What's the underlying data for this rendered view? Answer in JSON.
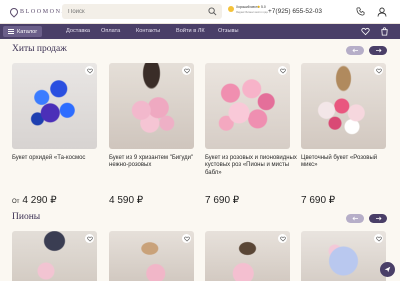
{
  "header": {
    "brand": "BLOOMONA",
    "search_placeholder": "Поиск",
    "rating": {
      "brand": "Яндекс",
      "label": "Хороший место",
      "score": "5.0",
      "sub": "Яндекс Бизнес место года"
    },
    "phone": "+7(925) 655-52-03"
  },
  "nav": {
    "catalog": "Каталог",
    "items": [
      "Доставка",
      "Оплата",
      "Контакты",
      "Войти в ЛК",
      "Отзывы"
    ]
  },
  "sections": [
    {
      "title": "Хиты продаж",
      "products": [
        {
          "name": "Букет орхидей «Та-космос",
          "price_prefix": "От",
          "price": "4 290 ₽"
        },
        {
          "name": "Букет из 9 хризантем \"Бигуди\" нежно-розовых",
          "price_prefix": "",
          "price": "4 590 ₽"
        },
        {
          "name": "Букет из розовых и пионовидных кустовых роз «Пионы и мисты бабл»",
          "price_prefix": "",
          "price": "7 690 ₽"
        },
        {
          "name": "Цветочный букет «Розовый микс»",
          "price_prefix": "",
          "price": "7 690 ₽"
        }
      ]
    },
    {
      "title": "Пионы"
    }
  ],
  "colors": {
    "accent": "#4a3f68",
    "accent_light": "#b6aec8",
    "background": "#fbf8f2"
  },
  "icons": [
    "search-icon",
    "phone-icon",
    "user-icon",
    "menu-icon",
    "heart-icon",
    "cart-icon",
    "arrow-left-icon",
    "arrow-right-icon",
    "chat-icon"
  ]
}
